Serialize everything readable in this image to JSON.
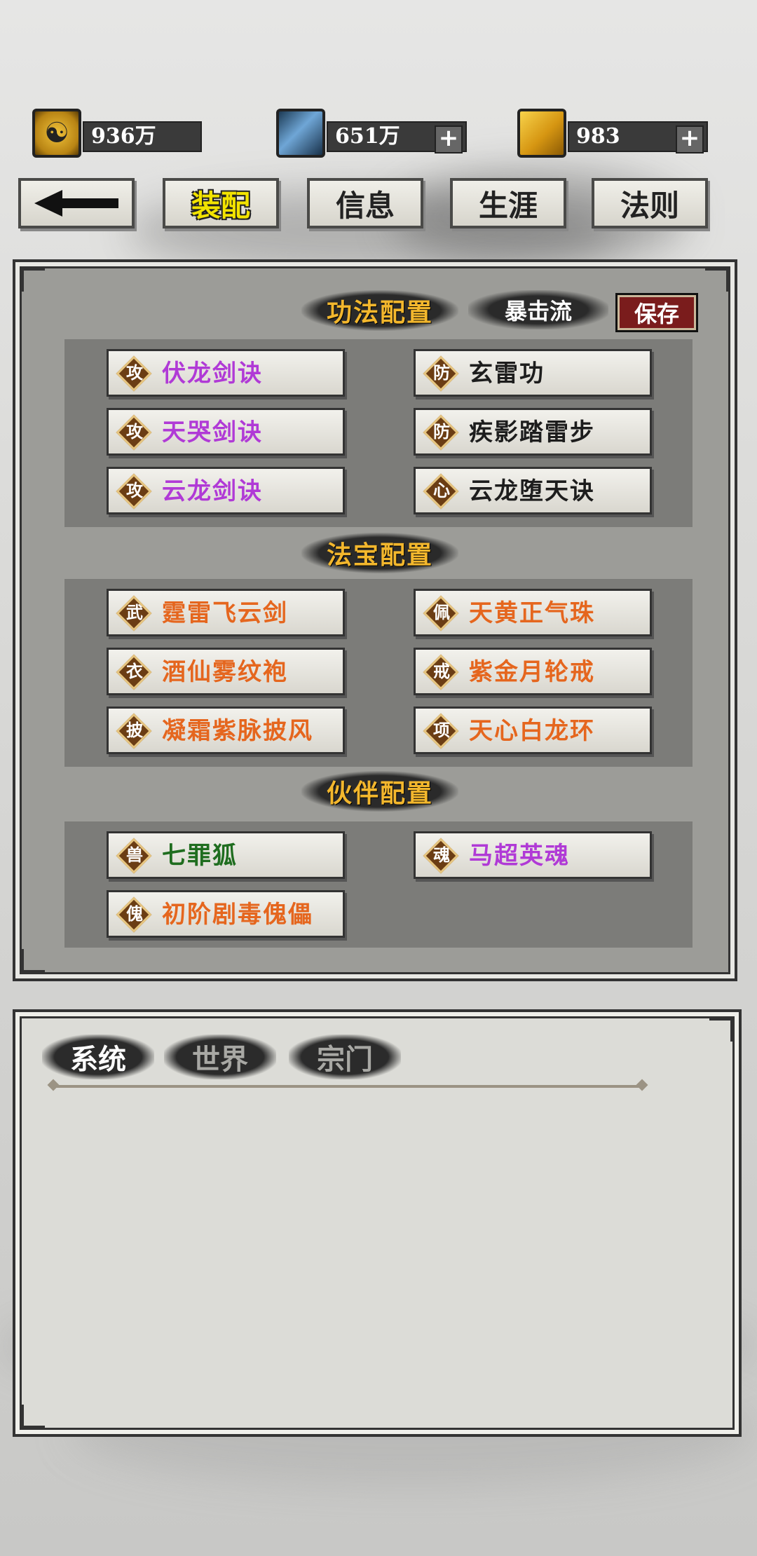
{
  "resources": [
    {
      "icon": "taiji-coin-icon",
      "value": "936万",
      "has_plus": false
    },
    {
      "icon": "blue-crystal-icon",
      "value": "651万",
      "has_plus": true
    },
    {
      "icon": "gold-gem-icon",
      "value": "983",
      "has_plus": true
    }
  ],
  "tabs": {
    "back_icon": "back-arrow-icon",
    "items": [
      {
        "label": "装配",
        "active": true
      },
      {
        "label": "信息",
        "active": false
      },
      {
        "label": "生涯",
        "active": false
      },
      {
        "label": "法则",
        "active": false
      }
    ]
  },
  "skills": {
    "title": "功法配置",
    "preset": "暴击流",
    "save_label": "保存",
    "slots": [
      {
        "badge": "攻",
        "name": "伏龙剑诀",
        "rarity": "purple"
      },
      {
        "badge": "防",
        "name": "玄雷功",
        "rarity": "black"
      },
      {
        "badge": "攻",
        "name": "天哭剑诀",
        "rarity": "purple"
      },
      {
        "badge": "防",
        "name": "疾影踏雷步",
        "rarity": "black"
      },
      {
        "badge": "攻",
        "name": "云龙剑诀",
        "rarity": "purple"
      },
      {
        "badge": "心",
        "name": "云龙堕天诀",
        "rarity": "black"
      }
    ]
  },
  "treasures": {
    "title": "法宝配置",
    "slots": [
      {
        "badge": "武",
        "name": "霆雷飞云剑",
        "rarity": "orange"
      },
      {
        "badge": "佩",
        "name": "天黄正气珠",
        "rarity": "orange"
      },
      {
        "badge": "衣",
        "name": "酒仙雾纹袍",
        "rarity": "orange"
      },
      {
        "badge": "戒",
        "name": "紫金月轮戒",
        "rarity": "orange"
      },
      {
        "badge": "披",
        "name": "凝霜紫脉披风",
        "rarity": "orange"
      },
      {
        "badge": "项",
        "name": "天心白龙环",
        "rarity": "orange"
      }
    ]
  },
  "partners": {
    "title": "伙伴配置",
    "slots": [
      {
        "badge": "兽",
        "name": "七罪狐",
        "rarity": "green"
      },
      {
        "badge": "魂",
        "name": "马超英魂",
        "rarity": "purple"
      },
      {
        "badge": "傀",
        "name": "初阶剧毒傀儡",
        "rarity": "orange"
      }
    ]
  },
  "chat": {
    "tabs": [
      {
        "label": "系统",
        "active": true
      },
      {
        "label": "世界",
        "active": false
      },
      {
        "label": "宗门",
        "active": false
      }
    ]
  },
  "colors": {
    "purple": "#b03ad6",
    "orange": "#e5661e",
    "green": "#1f6d1f",
    "black": "#1d1d1d",
    "title_gold": "#f3b72d",
    "save_red": "#7a1c1c"
  }
}
